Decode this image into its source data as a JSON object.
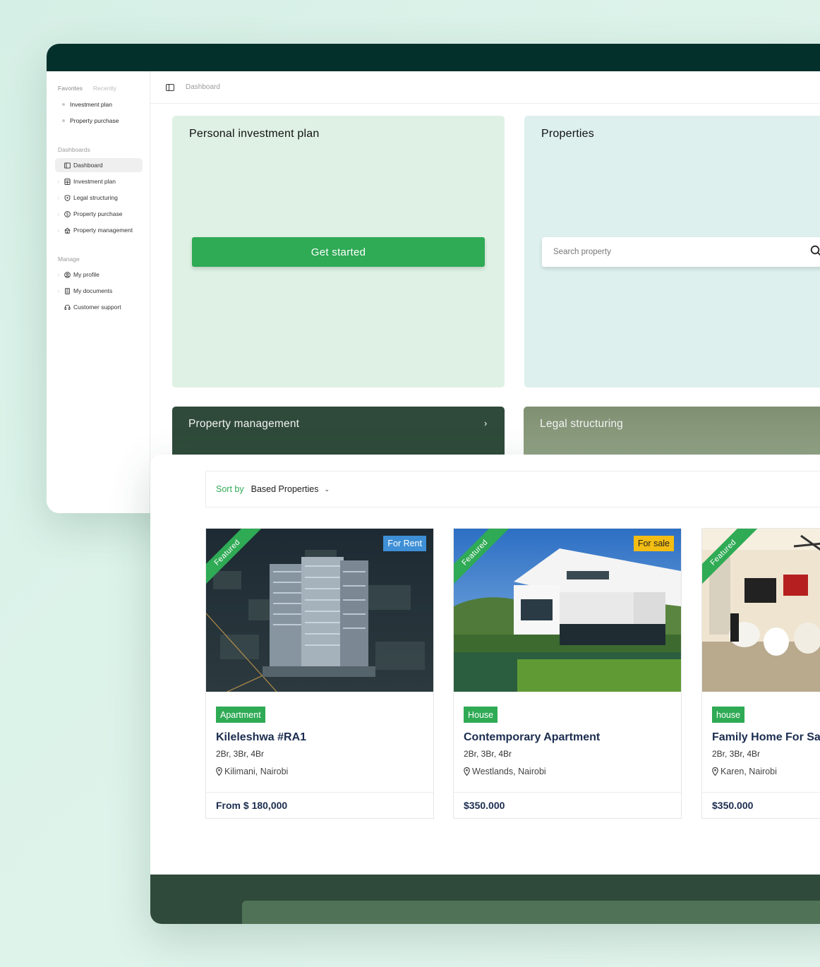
{
  "sidebar": {
    "tabs": [
      "Favorites",
      "Recently"
    ],
    "favorites": [
      "Investment plan",
      "Property purchase"
    ],
    "dashboards_label": "Dashboards",
    "dashboards": [
      "Dashboard",
      "Investment plan",
      "Legal structuring",
      "Property purchase",
      "Property management"
    ],
    "manage_label": "Manage",
    "manage": [
      "My profile",
      "My documents",
      "Customer support"
    ]
  },
  "breadcrumb": "Dashboard",
  "cards": {
    "invest_title": "Personal investment plan",
    "invest_button": "Get started",
    "props_title": "Properties",
    "search_placeholder": "Search property",
    "pm_title": "Property management",
    "legal_title": "Legal structuring"
  },
  "sort": {
    "label": "Sort by",
    "value": "Based Properties"
  },
  "listings": [
    {
      "ribbon": "Featured",
      "status": "For Rent",
      "type": "Apartment",
      "title": "Kileleshwa #RA1",
      "rooms": "2Br, 3Br, 4Br",
      "location": "Kilimani, Nairobi",
      "price": "From $ 180,000"
    },
    {
      "ribbon": "Featured",
      "status": "For sale",
      "type": "House",
      "title": "Contemporary Apartment",
      "rooms": "2Br, 3Br, 4Br",
      "location": "Westlands, Nairobi",
      "price": "$350.000"
    },
    {
      "ribbon": "Featured",
      "status": "",
      "type": "house",
      "title": "Family Home For Sa",
      "rooms": "2Br, 3Br, 4Br",
      "location": "Karen, Nairobi",
      "price": "$350.000"
    }
  ],
  "colors": {
    "brand_dark": "#03302b",
    "accent_green": "#2faa55",
    "rent_blue": "#3e8fd6",
    "sale_yellow": "#f4bd13"
  }
}
